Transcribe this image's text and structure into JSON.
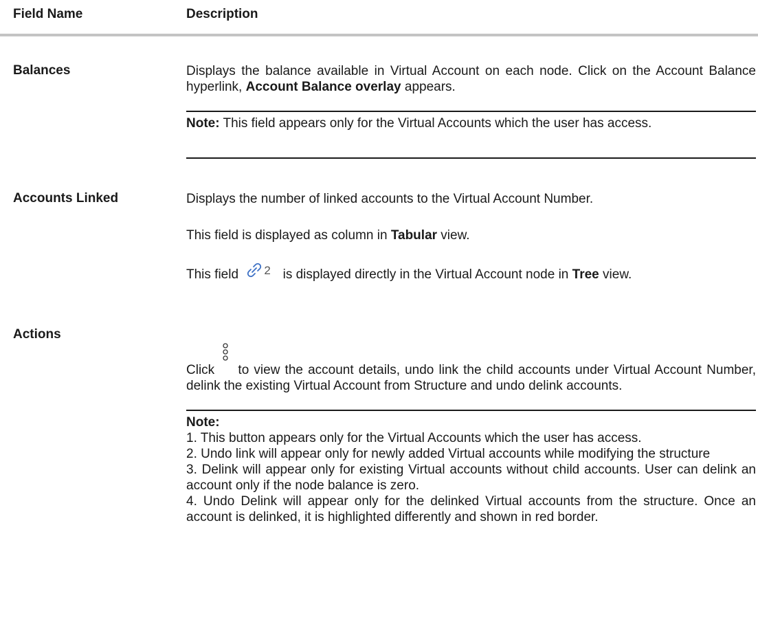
{
  "header": {
    "field_name": "Field Name",
    "description": "Description"
  },
  "balances": {
    "name": "Balances",
    "desc_a": "Displays the balance available in Virtual Account on each node. Click on the Account Balance hyperlink, ",
    "desc_bold": "Account Balance overlay",
    "desc_b": " appears.",
    "note_label": "Note:",
    "note_text": " This field appears only for the Virtual Accounts which the user has access."
  },
  "accounts_linked": {
    "name": "Accounts Linked",
    "desc": "Displays the number of linked accounts to the Virtual Account Number.",
    "tab_a": "This field is displayed as column in ",
    "tab_bold": "Tabular",
    "tab_b": " view.",
    "tree_a": "This field ",
    "tree_icon": "link-icon",
    "tree_count": "2",
    "tree_b": " is displayed directly in the Virtual Account node in ",
    "tree_bold": "Tree",
    "tree_c": " view."
  },
  "actions": {
    "name": "Actions",
    "desc_a": "Click ",
    "desc_icon": "kebab-menu-icon",
    "desc_b": " to view the account details, undo link the child accounts under Virtual Account Number, delink the existing Virtual Account from Structure and undo delink accounts.",
    "note_label": "Note:",
    "notes": [
      "1. This button appears only for the Virtual Accounts which the user has access.",
      "2. Undo link will appear only for newly added Virtual accounts while modifying the structure",
      "3. Delink will appear only for existing Virtual accounts without child accounts. User can delink an account only if the node balance is zero.",
      "4. Undo Delink will appear only for the delinked Virtual accounts from the structure. Once an account is delinked, it is highlighted differently and shown in red border."
    ]
  }
}
